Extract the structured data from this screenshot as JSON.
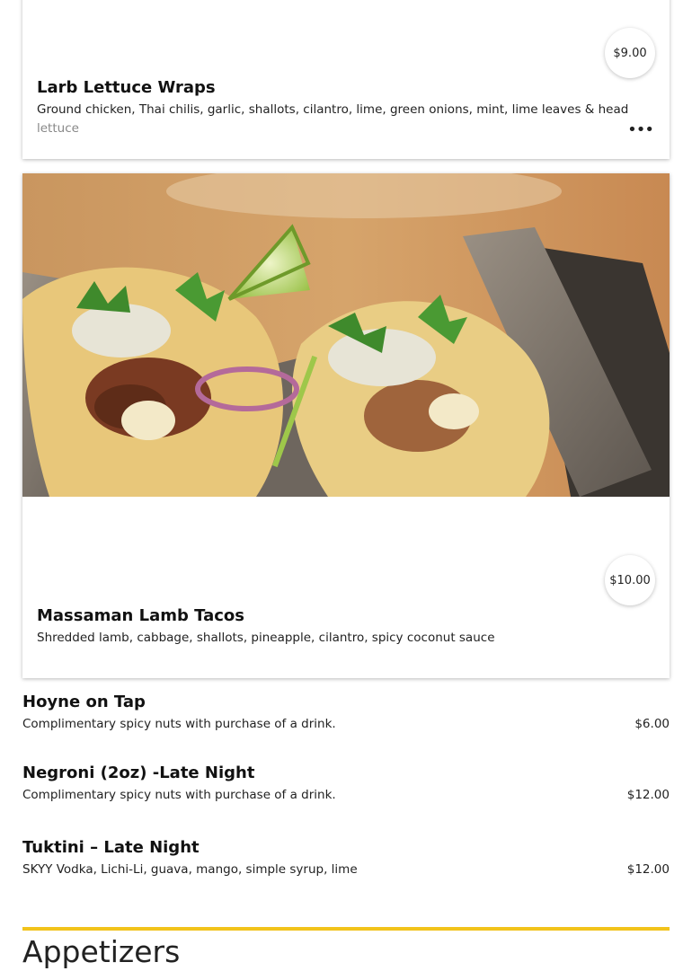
{
  "items": [
    {
      "title": "Larb Lettuce Wraps",
      "price": "$9.00",
      "description_main": "Ground chicken, Thai chilis, garlic, shallots, cilantro, lime, green onions, mint, lime leaves & head",
      "description_fade": "lettuce",
      "more_icon": "ellipsis-icon"
    },
    {
      "title": "Massaman Lamb Tacos",
      "price": "$10.00",
      "description": "Shredded lamb, cabbage, shallots, pineapple, cilantro, spicy coconut sauce",
      "image_icon": "tacos-photo"
    }
  ],
  "list_items": [
    {
      "title": "Hoyne on Tap",
      "description": "Complimentary spicy nuts with purchase of a drink.",
      "price": "$6.00"
    },
    {
      "title": "Negroni (2oz) -Late Night",
      "description": "Complimentary spicy nuts with purchase of a drink.",
      "price": "$12.00"
    },
    {
      "title": "Tuktini – Late Night",
      "description": "SKYY Vodka, Lichi-Li, guava, mango, simple syrup, lime",
      "price": "$12.00"
    }
  ],
  "section": {
    "title": "Appetizers",
    "rule_color": "#f2c31b"
  }
}
